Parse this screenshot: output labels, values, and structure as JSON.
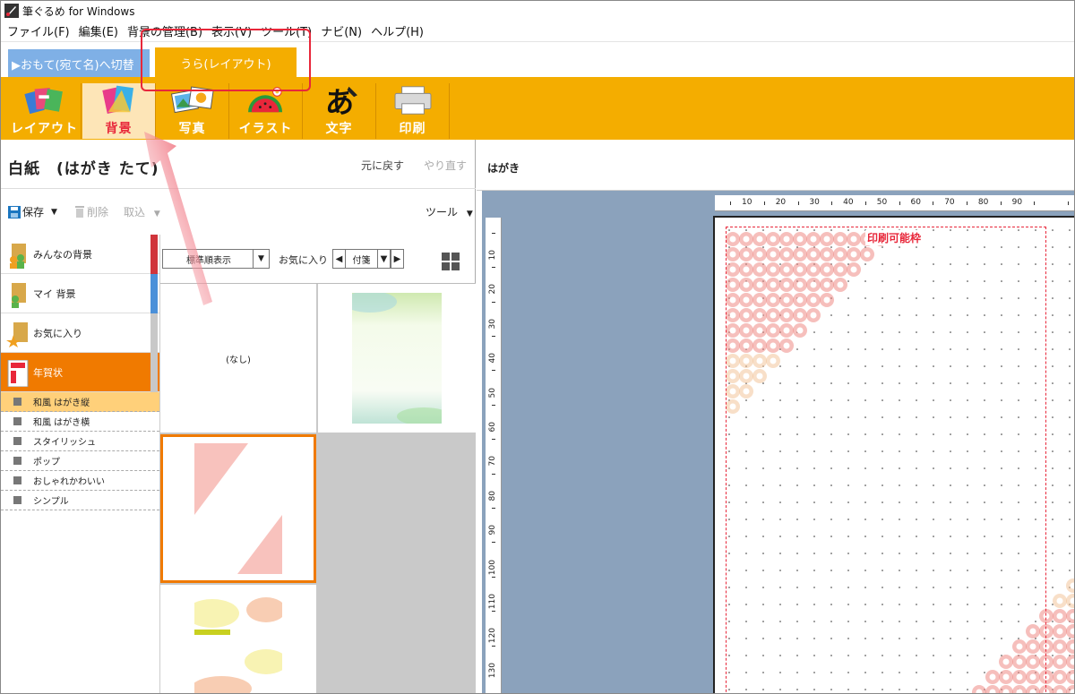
{
  "window": {
    "title": "筆ぐるめ for Windows"
  },
  "menu": [
    {
      "label": "ファイル(F)"
    },
    {
      "label": "編集(E)"
    },
    {
      "label": "背景の管理(B)"
    },
    {
      "label": "表示(V)"
    },
    {
      "label": "ツール(T)"
    },
    {
      "label": "ナビ(N)"
    },
    {
      "label": "ヘルプ(H)"
    }
  ],
  "side_tabs": {
    "front": "▶おもて(宛て名)へ切替",
    "back": "うら(レイアウト)"
  },
  "ribbon": [
    {
      "label": "レイアウト",
      "icon": "layout-icon"
    },
    {
      "label": "背景",
      "icon": "background-icon",
      "active": true
    },
    {
      "label": "写真",
      "icon": "photo-icon"
    },
    {
      "label": "イラスト",
      "icon": "illustration-icon"
    },
    {
      "label": "文字",
      "icon": "text-icon"
    },
    {
      "label": "印刷",
      "icon": "printer-icon"
    }
  ],
  "panel": {
    "title": "白紙　(はがき たて)",
    "undo": "元に戻す",
    "redo": "やり直す",
    "save": "保存",
    "delete": "削除",
    "import": "取込",
    "tools": "ツール"
  },
  "categories": [
    {
      "label": "みんなの背景",
      "color": "#d0343b"
    },
    {
      "label": "マイ 背景",
      "color": "#4a90d9"
    },
    {
      "label": "お気に入り",
      "color": "#c8c8c8"
    },
    {
      "label": "年賀状",
      "color": "#c8c8c8",
      "selected": true
    }
  ],
  "subcategories": [
    {
      "label": "和風 はがき縦",
      "selected": true
    },
    {
      "label": "和風 はがき横"
    },
    {
      "label": "スタイリッシュ"
    },
    {
      "label": "ポップ"
    },
    {
      "label": "おしゃれかわいい"
    },
    {
      "label": "シンプル"
    }
  ],
  "content": {
    "sort": "標準順表示",
    "favorites_label": "お気に入り",
    "favorites_value": "付箋",
    "thumb_none": "(なし)"
  },
  "right": {
    "header": "はがき"
  },
  "canvas": {
    "print_frame_label": "印刷可能枠",
    "ruler_h": [
      "10",
      "20",
      "30",
      "40",
      "50",
      "60",
      "70",
      "80",
      "90"
    ],
    "ruler_v": [
      "10",
      "20",
      "30",
      "40",
      "50",
      "60",
      "70",
      "80",
      "90",
      "100",
      "110",
      "120",
      "130"
    ]
  },
  "colors": {
    "accent": "#f4ad00",
    "selected": "#f07a00",
    "highlight": "#e8273a",
    "tab_front": "#7fb0e6",
    "canvas_bg": "#8ba2bc"
  }
}
